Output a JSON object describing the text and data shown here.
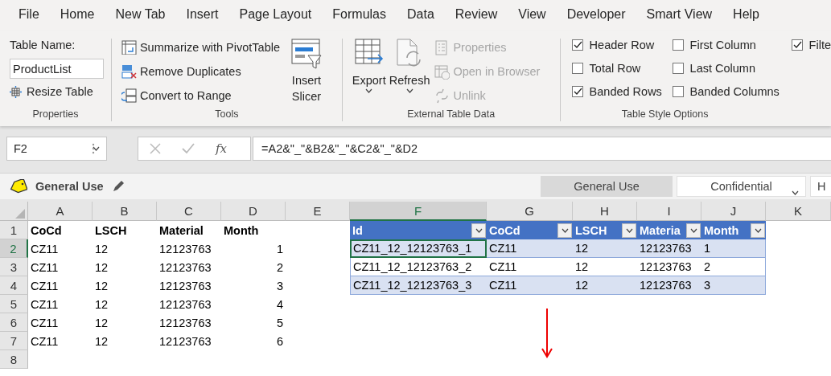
{
  "menu_tabs": [
    {
      "label": "File",
      "selected": false
    },
    {
      "label": "Home",
      "selected": false
    },
    {
      "label": "New Tab",
      "selected": false
    },
    {
      "label": "Insert",
      "selected": false
    },
    {
      "label": "Page Layout",
      "selected": false
    },
    {
      "label": "Formulas",
      "selected": false
    },
    {
      "label": "Data",
      "selected": false
    },
    {
      "label": "Review",
      "selected": false
    },
    {
      "label": "View",
      "selected": false
    },
    {
      "label": "Developer",
      "selected": false
    },
    {
      "label": "Smart View",
      "selected": false
    },
    {
      "label": "Help",
      "selected": false
    }
  ],
  "ribbon": {
    "properties": {
      "label": "Properties",
      "table_name_label": "Table Name:",
      "table_name": "ProductList",
      "resize": "Resize Table"
    },
    "tools": {
      "label": "Tools",
      "items": [
        {
          "kind": "pivot",
          "label": "Summarize with PivotTable"
        },
        {
          "kind": "duplicates",
          "label": "Remove Duplicates"
        },
        {
          "kind": "convert",
          "label": "Convert to Range"
        }
      ],
      "slicer": "Insert\nSlicer"
    },
    "external": {
      "label": "External Table Data",
      "export": "Export",
      "refresh": "Refresh",
      "items": [
        {
          "kind": "properties",
          "label": "Properties",
          "disabled": true
        },
        {
          "kind": "browser",
          "label": "Open in Browser",
          "disabled": true
        },
        {
          "kind": "unlink",
          "label": "Unlink",
          "disabled": true
        }
      ]
    },
    "style_options": {
      "label": "Table Style Options",
      "options": [
        {
          "label": "Header Row",
          "checked": true
        },
        {
          "label": "Total Row",
          "checked": false
        },
        {
          "label": "Banded Rows",
          "checked": true
        },
        {
          "label": "First Column",
          "checked": false
        },
        {
          "label": "Last Column",
          "checked": false
        },
        {
          "label": "Banded Columns",
          "checked": false
        },
        {
          "label": "Filte",
          "checked": true
        }
      ]
    }
  },
  "formula_bar": {
    "name_box": "F2",
    "fx": "fx",
    "formula": "=A2&\"_\"&B2&\"_\"&C2&\"_\"&D2"
  },
  "sensitivity_bar": {
    "label": "General Use",
    "buttons": [
      {
        "label": "General Use",
        "selected": true,
        "dropdown": false
      },
      {
        "label": "Confidential",
        "selected": false,
        "dropdown": true
      },
      {
        "label": "H",
        "selected": false,
        "dropdown": false
      }
    ]
  },
  "sheet": {
    "columns": [
      {
        "label": "A",
        "selected": false
      },
      {
        "label": "B",
        "selected": false
      },
      {
        "label": "C",
        "selected": false
      },
      {
        "label": "D",
        "selected": false
      },
      {
        "label": "E",
        "selected": false
      },
      {
        "label": "F",
        "selected": true
      },
      {
        "label": "G",
        "selected": false
      },
      {
        "label": "H",
        "selected": false
      },
      {
        "label": "I",
        "selected": false
      },
      {
        "label": "J",
        "selected": false
      },
      {
        "label": "K",
        "selected": false
      }
    ],
    "rows": [
      {
        "label": "1",
        "selected": false
      },
      {
        "label": "2",
        "selected": true
      },
      {
        "label": "3",
        "selected": false
      },
      {
        "label": "4",
        "selected": false
      },
      {
        "label": "5",
        "selected": false
      },
      {
        "label": "6",
        "selected": false
      },
      {
        "label": "7",
        "selected": false
      },
      {
        "label": "8",
        "selected": false
      }
    ],
    "range": {
      "columns": [
        {
          "label": "CoCd",
          "kind": "text"
        },
        {
          "label": "LSCH",
          "kind": "text"
        },
        {
          "label": "Material",
          "kind": "text"
        },
        {
          "label": "Month",
          "kind": "number"
        }
      ],
      "rows": [
        [
          "CZ11",
          "12",
          "12123763",
          "1"
        ],
        [
          "CZ11",
          "12",
          "12123763",
          "2"
        ],
        [
          "CZ11",
          "12",
          "12123763",
          "3"
        ],
        [
          "CZ11",
          "12",
          "12123763",
          "4"
        ],
        [
          "CZ11",
          "12",
          "12123763",
          "5"
        ],
        [
          "CZ11",
          "12",
          "12123763",
          "6"
        ]
      ]
    },
    "table": {
      "columns": [
        "Id",
        "CoCd",
        "LSCH",
        "Materia",
        "Month"
      ],
      "rows": [
        {
          "cells": [
            {
              "text": "CZ11_12_12123763_1",
              "selected": true
            },
            {
              "text": "CZ11",
              "selected": false
            },
            {
              "text": "12",
              "selected": false
            },
            {
              "text": "12123763",
              "selected": false
            },
            {
              "text": "1",
              "selected": false
            }
          ]
        },
        {
          "cells": [
            {
              "text": "CZ11_12_12123763_2",
              "selected": false
            },
            {
              "text": "CZ11",
              "selected": false
            },
            {
              "text": "12",
              "selected": false
            },
            {
              "text": "12123763",
              "selected": false
            },
            {
              "text": "2",
              "selected": false
            }
          ]
        },
        {
          "cells": [
            {
              "text": "CZ11_12_12123763_3",
              "selected": false
            },
            {
              "text": "CZ11",
              "selected": false
            },
            {
              "text": "12",
              "selected": false
            },
            {
              "text": "12123763",
              "selected": false
            },
            {
              "text": "3",
              "selected": false
            }
          ]
        }
      ]
    }
  }
}
